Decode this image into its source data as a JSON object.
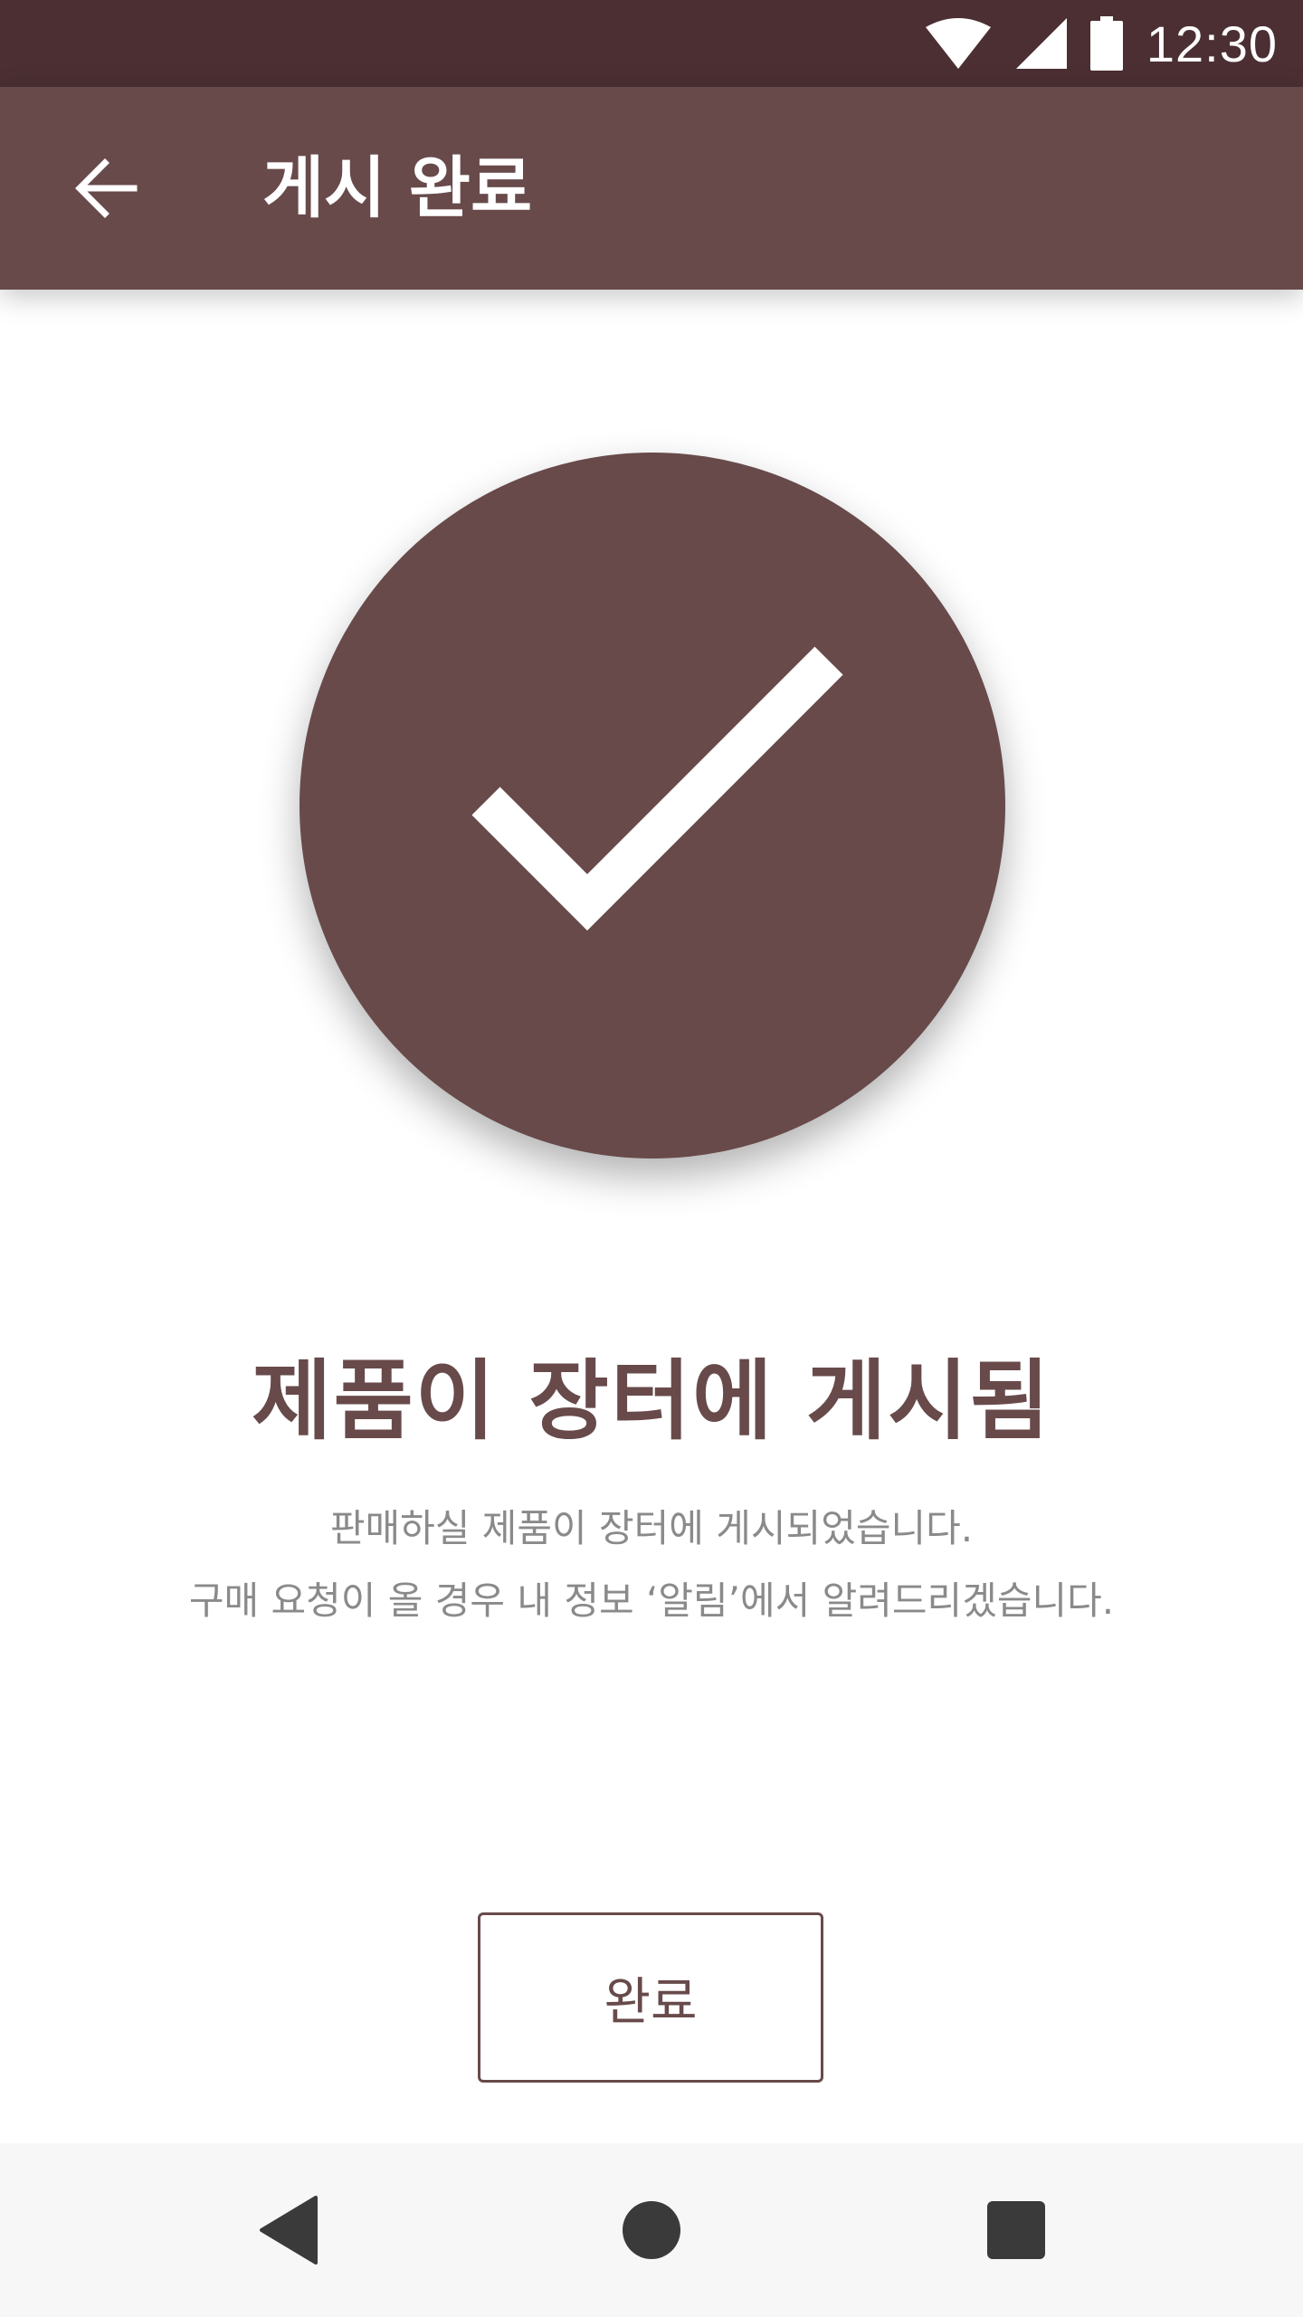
{
  "status_bar": {
    "time": "12:30",
    "icons": [
      "wifi-icon",
      "signal-icon",
      "battery-icon"
    ]
  },
  "app_bar": {
    "title": "게시 완료",
    "back_icon": "arrow-back-icon"
  },
  "success": {
    "icon": "check-icon",
    "headline": "제품이 장터에 게시됨",
    "description_line1": "판매하실 제품이 장터에 게시되었습니다.",
    "description_line2": "구매 요청이 올 경우 내 정보 ‘알림’에서 알려드리겠습니다."
  },
  "actions": {
    "done_label": "완료"
  },
  "nav_bar": {
    "icons": [
      "nav-back-icon",
      "nav-home-icon",
      "nav-recents-icon"
    ]
  },
  "colors": {
    "status_bar": "#4b2f32",
    "primary": "#684a4b",
    "description_text": "#8a8a8a",
    "nav_bar": "#f7f7f7"
  }
}
